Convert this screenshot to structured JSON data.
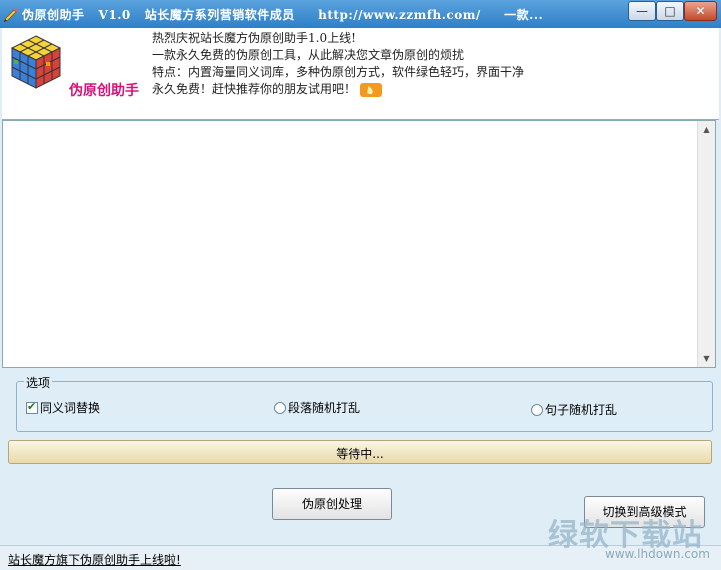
{
  "titlebar": {
    "title": "伪原创助手   V1.0   站长魔方系列营销软件成员     http://www.zzmfh.com/     一款...",
    "minimize_glyph": "—",
    "maximize_glyph": "□",
    "close_glyph": "✕"
  },
  "header": {
    "app_name": "伪原创助手",
    "promo_lines": [
      "热烈庆祝站长魔方伪原创助手1.0上线!",
      "一款永久免费的伪原创工具，从此解决您文章伪原创的烦扰",
      "特点：内置海量同义词库，多种伪原创方式，软件绿色轻巧，界面干净",
      "永久免费！赶快推荐你的朋友试用吧！"
    ],
    "fire_icon": "fire-icon"
  },
  "editor": {
    "value": ""
  },
  "options": {
    "group_label": "选项",
    "items": [
      {
        "label": "同义词替换",
        "type": "checkbox",
        "checked": true
      },
      {
        "label": "段落随机打乱",
        "type": "radio",
        "checked": false
      },
      {
        "label": "句子随机打乱",
        "type": "radio",
        "checked": false
      }
    ]
  },
  "progress": {
    "text": "等待中...",
    "value": 0
  },
  "buttons": {
    "process_label": "伪原创处理",
    "switch_label": "切换到高级模式"
  },
  "status": {
    "link_text": "站长魔方旗下伪原创助手上线啦!"
  },
  "watermark": {
    "text": "绿软下载站",
    "sub": "www.lhdown.com"
  },
  "colors": {
    "titlebar": "#2f7fc7",
    "app_name": "#d4147a",
    "background": "#dfeef6"
  }
}
